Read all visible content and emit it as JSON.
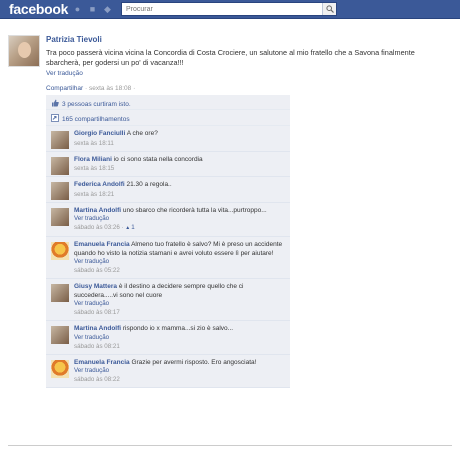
{
  "header": {
    "logo": "facebook",
    "search_placeholder": "Procurar",
    "accent": "#3b5998"
  },
  "post": {
    "author": "Patrizia Tievoli",
    "text": "Tra poco passerà vicina vicina la Concordia di Costa Crociere, un salutone al mio fratello che a Savona finalmente sbarcherà, per godersi un po' di vacanza!!!",
    "translate": "Ver tradução",
    "share": "Compartilhar",
    "sep": " · ",
    "time": "sexta às 18:08",
    "after_time": " · "
  },
  "feedback": {
    "likes": "3 pessoas curtiram isto.",
    "shares": "165 compartilhamentos"
  },
  "comments": [
    {
      "name": "Giorgio Fanciulli",
      "text": "A che ore?",
      "translate": "",
      "time": "sexta às 18:11",
      "avatar": "person"
    },
    {
      "name": "Flora Miliani",
      "text": "io ci sono stata nella concordia",
      "translate": "",
      "time": "sexta às 18:15",
      "avatar": "person"
    },
    {
      "name": "Federica Andolfi",
      "text": "21.30 a regola..",
      "translate": "",
      "time": "sexta às 18:21",
      "avatar": "person"
    },
    {
      "name": "Martina Andolfi",
      "text": "uno sbarco che ricorderà tutta la vita...purtroppo...",
      "translate": "Ver tradução",
      "time": "sábado às 03:26 · ",
      "likes": "1",
      "avatar": "person"
    },
    {
      "name": "Emanuela Francia",
      "text": "Almeno tuo fratello è salvo? Mi è preso un accidente quando ho visto la notizia stamani e avrei voluto essere lì per aiutare!",
      "translate": "Ver tradução",
      "time": "sábado às 05:22",
      "avatar": "cartoon"
    },
    {
      "name": "Giusy Mattera",
      "text": "è il destino a decidere sempre quello che ci succedera.....vi sono nel cuore",
      "translate": "Ver tradução",
      "time": "sábado às 08:17",
      "avatar": "person"
    },
    {
      "name": "Martina Andolfi",
      "text": "rispondo io x mamma...si zio è salvo...",
      "translate": "Ver tradução",
      "time": "sábado às 08:21",
      "avatar": "person"
    },
    {
      "name": "Emanuela Francia",
      "text": "Grazie per avermi risposto. Ero angosciata!",
      "translate": "Ver tradução",
      "time": "sábado às 08:22",
      "avatar": "cartoon"
    }
  ]
}
